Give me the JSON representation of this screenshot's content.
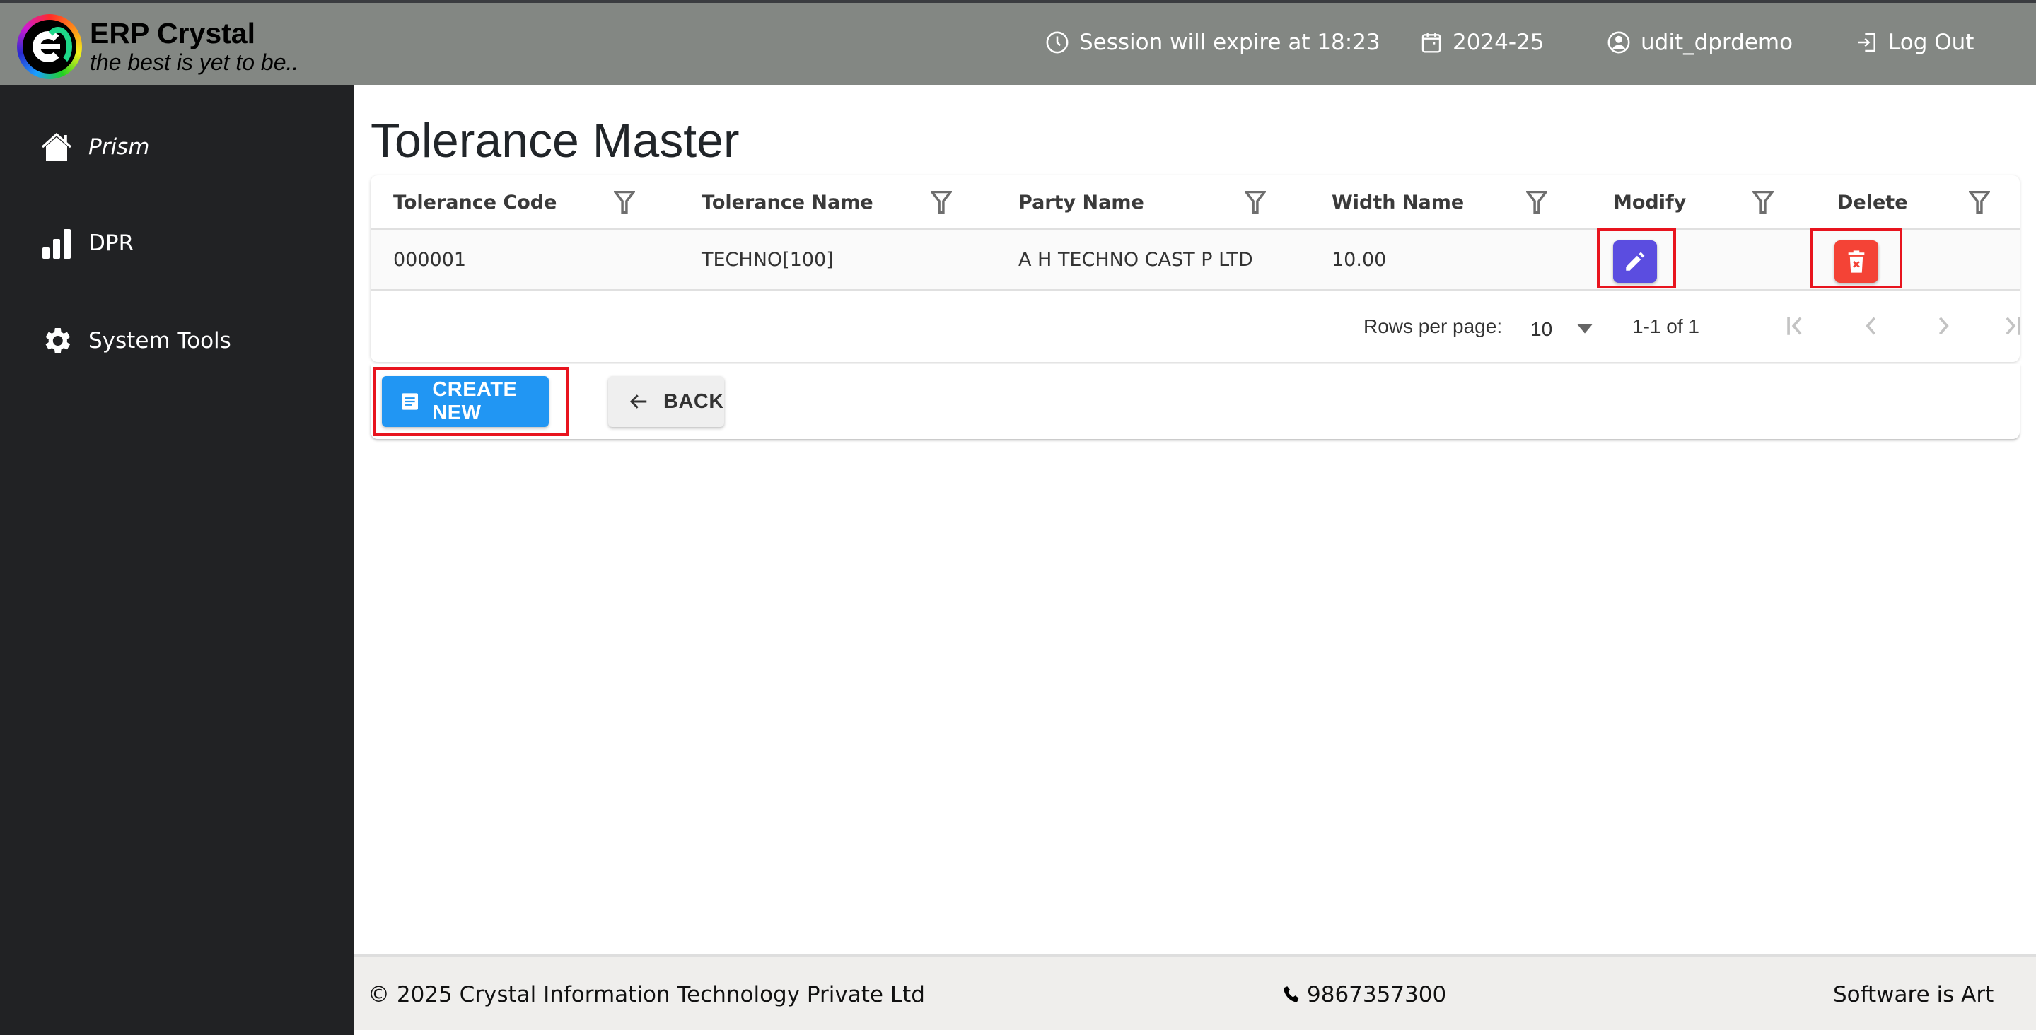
{
  "app": {
    "brand_name": "ERP Crystal",
    "brand_tagline": "the best is yet to be.."
  },
  "header": {
    "session_text": "Session will expire at 18:23",
    "financial_year": "2024-25",
    "username": "udit_dprdemo",
    "logout_label": "Log Out"
  },
  "sidebar": {
    "items": [
      {
        "label": "Prism",
        "icon": "home-icon"
      },
      {
        "label": "DPR",
        "icon": "bar-chart-icon"
      },
      {
        "label": "System Tools",
        "icon": "gear-icon"
      }
    ]
  },
  "page": {
    "title": "Tolerance Master"
  },
  "table": {
    "columns": [
      "Tolerance Code",
      "Tolerance Name",
      "Party Name",
      "Width Name",
      "Modify",
      "Delete"
    ],
    "rows": [
      {
        "tolerance_code": "000001",
        "tolerance_name": "TECHNO[100]",
        "party_name": "A H TECHNO CAST P LTD",
        "width_name": "10.00"
      }
    ],
    "pagination": {
      "rows_per_page_label": "Rows per page:",
      "rows_per_page_value": "10",
      "range_text": "1-1 of 1"
    }
  },
  "actions": {
    "create_new_label": "CREATE NEW",
    "back_label": "BACK"
  },
  "footer": {
    "copyright": "© 2025 Crystal Information Technology Private Ltd",
    "phone": "9867357300",
    "slogan": "Software is Art"
  },
  "colors": {
    "header_bg": "#838783",
    "sidebar_bg": "#212224",
    "modify_button": "#5b4de0",
    "delete_button": "#f44336",
    "create_button": "#2196f3",
    "highlight_box": "#e8141e"
  }
}
